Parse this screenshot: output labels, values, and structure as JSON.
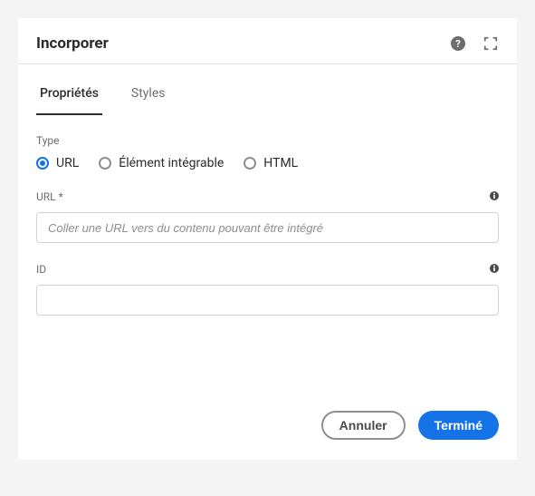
{
  "header": {
    "title": "Incorporer"
  },
  "tabs": {
    "properties": "Propriétés",
    "styles": "Styles"
  },
  "type_section": {
    "label": "Type",
    "options": {
      "url": "URL",
      "embeddable": "Élément intégrable",
      "html": "HTML"
    }
  },
  "url_field": {
    "label": "URL *",
    "placeholder": "Coller une URL vers du contenu pouvant être intégré",
    "value": ""
  },
  "id_field": {
    "label": "ID",
    "value": ""
  },
  "buttons": {
    "cancel": "Annuler",
    "done": "Terminé"
  }
}
